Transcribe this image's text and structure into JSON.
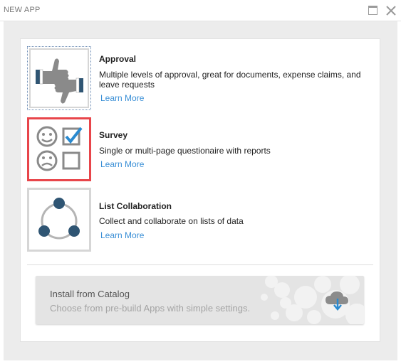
{
  "window": {
    "title": "NEW APP"
  },
  "apps": [
    {
      "title": "Approval",
      "description": "Multiple levels of approval, great for documents, expense claims, and leave requests",
      "link": "Learn More"
    },
    {
      "title": "Survey",
      "description": "Single or multi-page questionaire with reports",
      "link": "Learn More"
    },
    {
      "title": "List Collaboration",
      "description": "Collect and collaborate on lists of data",
      "link": "Learn More"
    }
  ],
  "catalog": {
    "title": "Install from Catalog",
    "subtitle": "Choose from pre-build Apps with simple settings."
  },
  "colors": {
    "link": "#3a8fd6",
    "selected_border": "#e8454a",
    "icon_dark": "#2f5573",
    "icon_gray": "#8a8a8a",
    "check_blue": "#2a8ad0"
  },
  "icons": [
    "maximize-icon",
    "close-icon",
    "thumbs-icon",
    "smiley-icon",
    "checkbox-checked-icon",
    "sad-face-icon",
    "checkbox-empty-icon",
    "collaboration-cycle-icon",
    "cloud-download-icon"
  ]
}
